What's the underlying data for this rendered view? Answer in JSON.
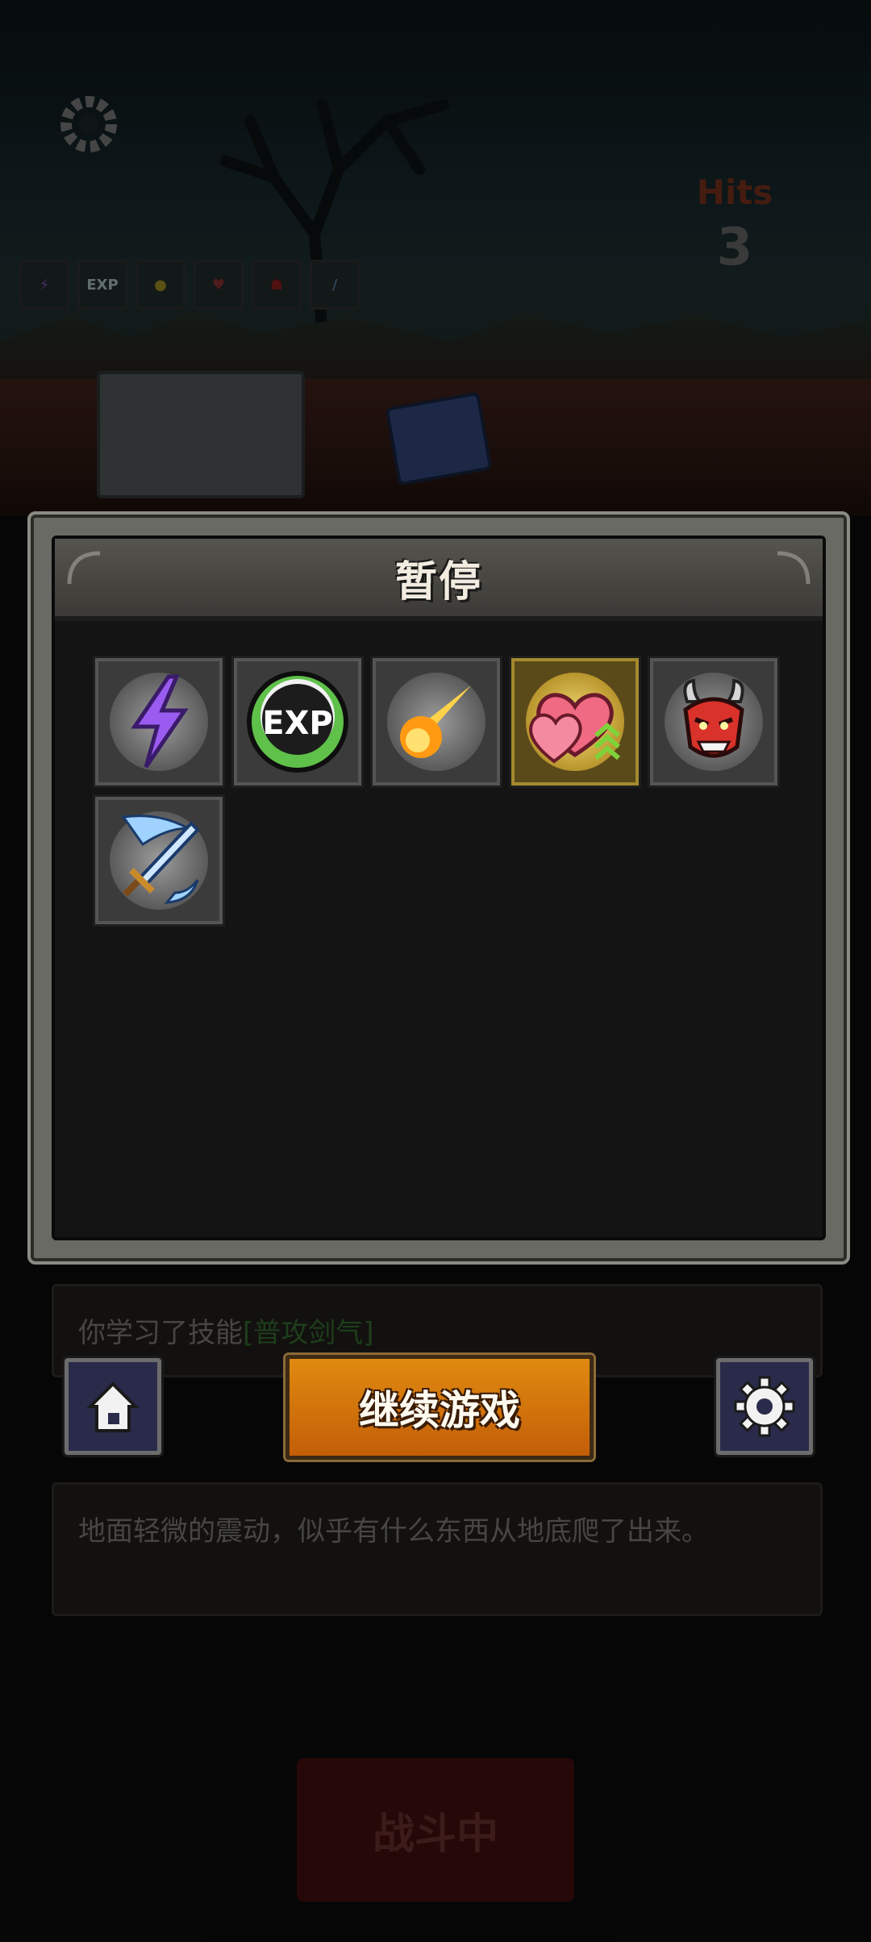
{
  "hud": {
    "hits_label": "Hits",
    "hits_value": "3",
    "mini_skills": [
      "lightning-icon",
      "EXP",
      "fireball-icon",
      "hearts-icon",
      "oni-mask-icon",
      "ice-sword-icon"
    ]
  },
  "pause_panel": {
    "title": "暂停",
    "skills": [
      {
        "icon": "lightning-icon",
        "highlight": false
      },
      {
        "icon": "exp-icon",
        "label": "EXP",
        "highlight": false
      },
      {
        "icon": "fireball-icon",
        "highlight": false
      },
      {
        "icon": "hearts-upgrade-icon",
        "highlight": true
      },
      {
        "icon": "oni-mask-icon",
        "highlight": false
      },
      {
        "icon": "ice-sword-icon",
        "highlight": false
      }
    ]
  },
  "buttons": {
    "continue_label": "继续游戏",
    "home_icon": "home-icon",
    "settings_icon": "gear-icon"
  },
  "log": {
    "line1_prefix": "你学习了技能",
    "line1_skill": "[普攻剑气]",
    "line2": "地面轻微的震动，似乎有什么东西从地底爬了出来。"
  },
  "battle_button": "战斗中",
  "colors": {
    "accent_orange": "#d87410",
    "panel_dark": "#141414",
    "skill_highlight_gold": "#a38a2e"
  }
}
